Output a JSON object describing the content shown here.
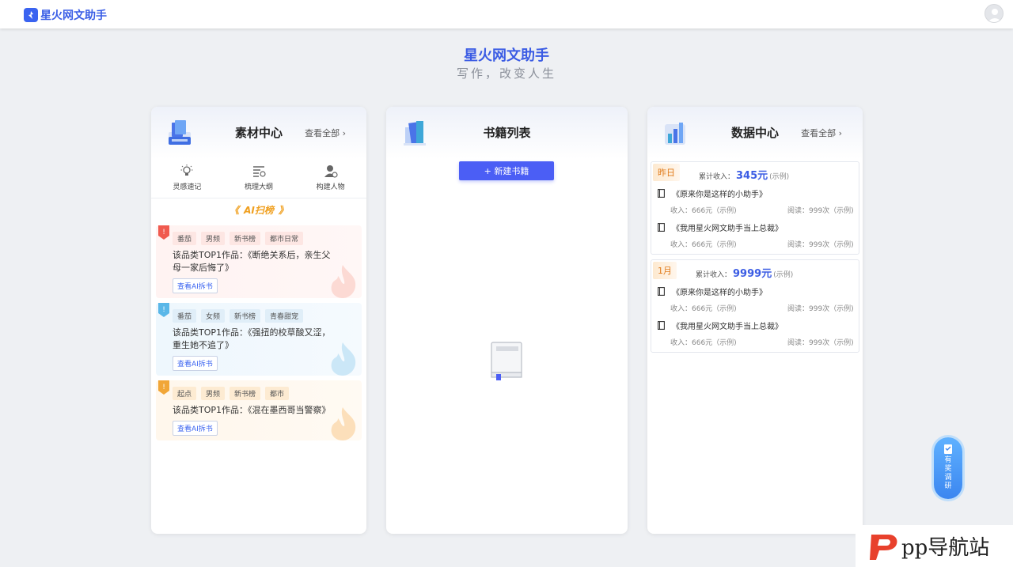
{
  "app": {
    "name": "星火网文助手"
  },
  "hero": {
    "title": "星火网文助手",
    "subtitle": "写作，改变人生"
  },
  "material": {
    "title": "素材中心",
    "see_all": "查看全部 ›",
    "tools": [
      {
        "label": "灵感速记",
        "icon": "lightbulb-icon"
      },
      {
        "label": "梳理大纲",
        "icon": "outline-list-icon"
      },
      {
        "label": "构建人物",
        "icon": "person-build-icon"
      }
    ],
    "ai_section_label": "AI扫榜",
    "ranks": [
      {
        "tags": [
          "番茄",
          "男频",
          "新书榜",
          "都市日常"
        ],
        "desc": "该品类TOP1作品：《断绝关系后，亲生父母一家后悔了》",
        "button": "查看AI拆书",
        "color": "#f05a4f"
      },
      {
        "tags": [
          "番茄",
          "女频",
          "新书榜",
          "青春甜宠"
        ],
        "desc": "该品类TOP1作品：《强扭的校草酸又涩，重生她不追了》",
        "button": "查看AI拆书",
        "color": "#5ab7e8"
      },
      {
        "tags": [
          "起点",
          "男频",
          "新书榜",
          "都市"
        ],
        "desc": "该品类TOP1作品：《混在墨西哥当警察》",
        "button": "查看AI拆书",
        "color": "#f1a637"
      }
    ]
  },
  "books": {
    "title": "书籍列表",
    "new_button": "+ 新建书籍"
  },
  "data_center": {
    "title": "数据中心",
    "see_all": "查看全部 ›",
    "blocks": [
      {
        "period": "昨日",
        "total_label": "累计收入：",
        "total_value": "345元",
        "total_note": "(示例)",
        "items": [
          {
            "name": "《原来你是这样的小助手》",
            "income": "收入：666元（示例)",
            "reads": "阅读：999次（示例)"
          },
          {
            "name": "《我用星火网文助手当上总裁》",
            "income": "收入：666元（示例)",
            "reads": "阅读：999次（示例)"
          }
        ]
      },
      {
        "period": "1月",
        "total_label": "累计收入：",
        "total_value": "9999元",
        "total_note": "(示例)",
        "items": [
          {
            "name": "《原来你是这样的小助手》",
            "income": "收入：666元（示例)",
            "reads": "阅读：999次（示例)"
          },
          {
            "name": "《我用星火网文助手当上总裁》",
            "income": "收入：666元（示例)",
            "reads": "阅读：999次（示例)"
          }
        ]
      }
    ]
  },
  "survey": {
    "label": "有奖调研"
  },
  "watermark": {
    "text": "pp导航站"
  },
  "colors": {
    "brand": "#3b5ce4",
    "button": "#4b5ef5",
    "background": "#eef0f3"
  }
}
